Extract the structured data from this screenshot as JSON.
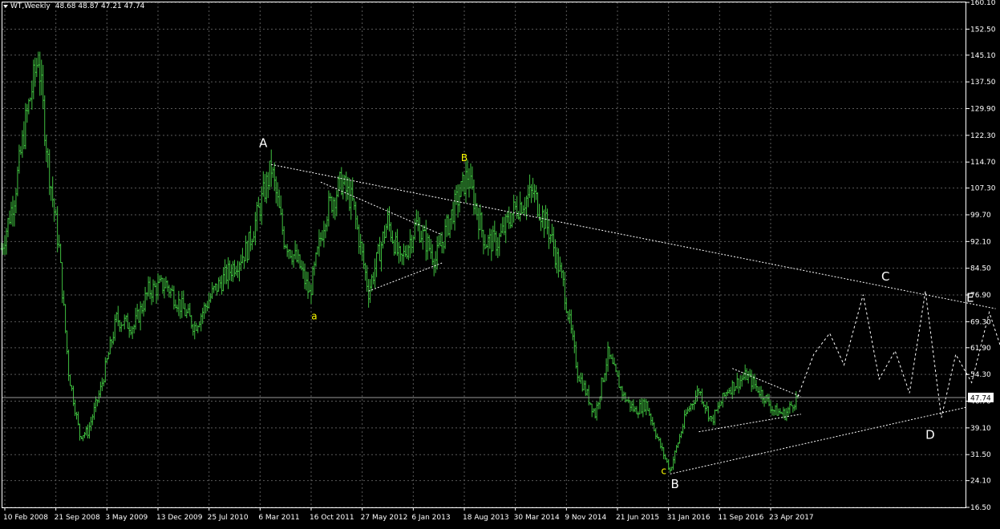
{
  "header": {
    "symbol": "WT,Weekly",
    "ohlc": "48.68 48.87 47.21 47.74"
  },
  "price_tag": "47.74",
  "colors": {
    "background": "#000000",
    "grid": "#5a5a5a",
    "bars": "#3fbf3f",
    "projection": "#ffffff",
    "wave_letters_major": "#ffffff",
    "wave_letters_minor": "#ffff00",
    "frame": "#ffffff"
  },
  "chart_data": {
    "type": "line",
    "style": "ohlc-bars",
    "grid": true,
    "ylim": [
      16.5,
      160.1
    ],
    "y_ticks": [
      "160.10",
      "152.50",
      "145.10",
      "137.50",
      "129.90",
      "122.30",
      "114.70",
      "107.30",
      "99.70",
      "92.10",
      "84.50",
      "76.90",
      "69.30",
      "61.90",
      "54.30",
      "46.70",
      "39.10",
      "31.50",
      "24.10",
      "16.50"
    ],
    "x_ticks": [
      "10 Feb 2008",
      "21 Sep 2008",
      "3 May 2009",
      "13 Dec 2009",
      "25 Jul 2010",
      "6 Mar 2011",
      "16 Oct 2011",
      "27 May 2012",
      "6 Jan 2013",
      "18 Aug 2013",
      "30 Mar 2014",
      "9 Nov 2014",
      "21 Jun 2015",
      "31 Jan 2016",
      "11 Sep 2016",
      "23 Apr 2017"
    ],
    "last_price": 47.74,
    "price_path": [
      {
        "t": "2008-01-27",
        "v": 90
      },
      {
        "t": "2008-03-23",
        "v": 105
      },
      {
        "t": "2008-05-11",
        "v": 126
      },
      {
        "t": "2008-07-06",
        "v": 145
      },
      {
        "t": "2008-08-17",
        "v": 115
      },
      {
        "t": "2008-10-05",
        "v": 90
      },
      {
        "t": "2008-11-16",
        "v": 55
      },
      {
        "t": "2009-01-04",
        "v": 37
      },
      {
        "t": "2009-02-08",
        "v": 38
      },
      {
        "t": "2009-04-05",
        "v": 50
      },
      {
        "t": "2009-06-14",
        "v": 70
      },
      {
        "t": "2009-08-30",
        "v": 68
      },
      {
        "t": "2009-11-01",
        "v": 78
      },
      {
        "t": "2010-01-17",
        "v": 80
      },
      {
        "t": "2010-05-23",
        "v": 68
      },
      {
        "t": "2010-08-15",
        "v": 78
      },
      {
        "t": "2010-11-07",
        "v": 85
      },
      {
        "t": "2011-01-09",
        "v": 90
      },
      {
        "t": "2011-04-24",
        "v": 113
      },
      {
        "t": "2011-06-19",
        "v": 93
      },
      {
        "t": "2011-08-28",
        "v": 85
      },
      {
        "t": "2011-10-09",
        "v": 77
      },
      {
        "t": "2011-12-18",
        "v": 100
      },
      {
        "t": "2012-02-26",
        "v": 109
      },
      {
        "t": "2012-04-15",
        "v": 103
      },
      {
        "t": "2012-06-24",
        "v": 78
      },
      {
        "t": "2012-09-16",
        "v": 98
      },
      {
        "t": "2012-11-11",
        "v": 86
      },
      {
        "t": "2013-01-20",
        "v": 97
      },
      {
        "t": "2013-04-14",
        "v": 87
      },
      {
        "t": "2013-06-30",
        "v": 101
      },
      {
        "t": "2013-09-01",
        "v": 111
      },
      {
        "t": "2013-11-17",
        "v": 92
      },
      {
        "t": "2014-01-12",
        "v": 92
      },
      {
        "t": "2014-03-23",
        "v": 101
      },
      {
        "t": "2014-06-15",
        "v": 106
      },
      {
        "t": "2014-08-31",
        "v": 94
      },
      {
        "t": "2014-10-26",
        "v": 80
      },
      {
        "t": "2014-12-28",
        "v": 55
      },
      {
        "t": "2015-03-15",
        "v": 43
      },
      {
        "t": "2015-05-10",
        "v": 60
      },
      {
        "t": "2015-07-19",
        "v": 48
      },
      {
        "t": "2015-09-06",
        "v": 44
      },
      {
        "t": "2015-10-25",
        "v": 46
      },
      {
        "t": "2015-12-20",
        "v": 35
      },
      {
        "t": "2016-02-07",
        "v": 27
      },
      {
        "t": "2016-04-17",
        "v": 43
      },
      {
        "t": "2016-06-12",
        "v": 50
      },
      {
        "t": "2016-08-07",
        "v": 41
      },
      {
        "t": "2016-10-16",
        "v": 50
      },
      {
        "t": "2017-01-08",
        "v": 54
      },
      {
        "t": "2017-03-26",
        "v": 48
      },
      {
        "t": "2017-05-07",
        "v": 44
      },
      {
        "t": "2017-06-25",
        "v": 43
      },
      {
        "t": "2017-08-20",
        "v": 48
      }
    ],
    "wave_labels": [
      {
        "text": "A",
        "t": "2011-03-20",
        "v": 119,
        "color": "white"
      },
      {
        "text": "a",
        "t": "2011-10-30",
        "v": 70,
        "color": "yellow"
      },
      {
        "text": "B",
        "t": "2013-08-18",
        "v": 115,
        "color": "yellow"
      },
      {
        "text": "c",
        "t": "2016-01-10",
        "v": 26,
        "color": "yellow"
      },
      {
        "text": "B",
        "t": "2016-02-28",
        "v": 22,
        "color": "white"
      },
      {
        "text": "C",
        "t": "2018-09-09",
        "v": 81,
        "color": "white"
      },
      {
        "text": "D",
        "t": "2019-03-24",
        "v": 36,
        "color": "white"
      },
      {
        "text": "E",
        "t": "2019-09-15",
        "v": 75,
        "color": "white"
      }
    ],
    "trendlines": [
      {
        "from": {
          "t": "2011-04-24",
          "v": 114
        },
        "to": {
          "t": "2020-01-05",
          "v": 73
        }
      },
      {
        "from": {
          "t": "2016-02-07",
          "v": 26
        },
        "to": {
          "t": "2019-09-01",
          "v": 45
        }
      },
      {
        "from": {
          "t": "2011-11-27",
          "v": 109
        },
        "to": {
          "t": "2013-05-12",
          "v": 94
        }
      },
      {
        "from": {
          "t": "2012-06-24",
          "v": 78
        },
        "to": {
          "t": "2013-05-12",
          "v": 86
        }
      },
      {
        "from": {
          "t": "2016-11-06",
          "v": 56
        },
        "to": {
          "t": "2017-09-03",
          "v": 48
        }
      },
      {
        "from": {
          "t": "2016-06-12",
          "v": 38
        },
        "to": {
          "t": "2017-09-03",
          "v": 43
        }
      }
    ],
    "projection_path": [
      {
        "t": "2017-08-20",
        "v": 48
      },
      {
        "t": "2017-10-29",
        "v": 60
      },
      {
        "t": "2018-01-07",
        "v": 66
      },
      {
        "t": "2018-03-11",
        "v": 57
      },
      {
        "t": "2018-06-03",
        "v": 77
      },
      {
        "t": "2018-08-12",
        "v": 53
      },
      {
        "t": "2018-10-21",
        "v": 61
      },
      {
        "t": "2018-12-23",
        "v": 49
      },
      {
        "t": "2019-03-03",
        "v": 78
      },
      {
        "t": "2019-05-12",
        "v": 42
      },
      {
        "t": "2019-07-14",
        "v": 60
      },
      {
        "t": "2019-09-22",
        "v": 52
      },
      {
        "t": "2019-12-08",
        "v": 72
      },
      {
        "t": "2020-03-29",
        "v": 50
      },
      {
        "t": "2020-08-30",
        "v": 31
      },
      {
        "t": "2020-11-15",
        "v": 24
      }
    ]
  }
}
